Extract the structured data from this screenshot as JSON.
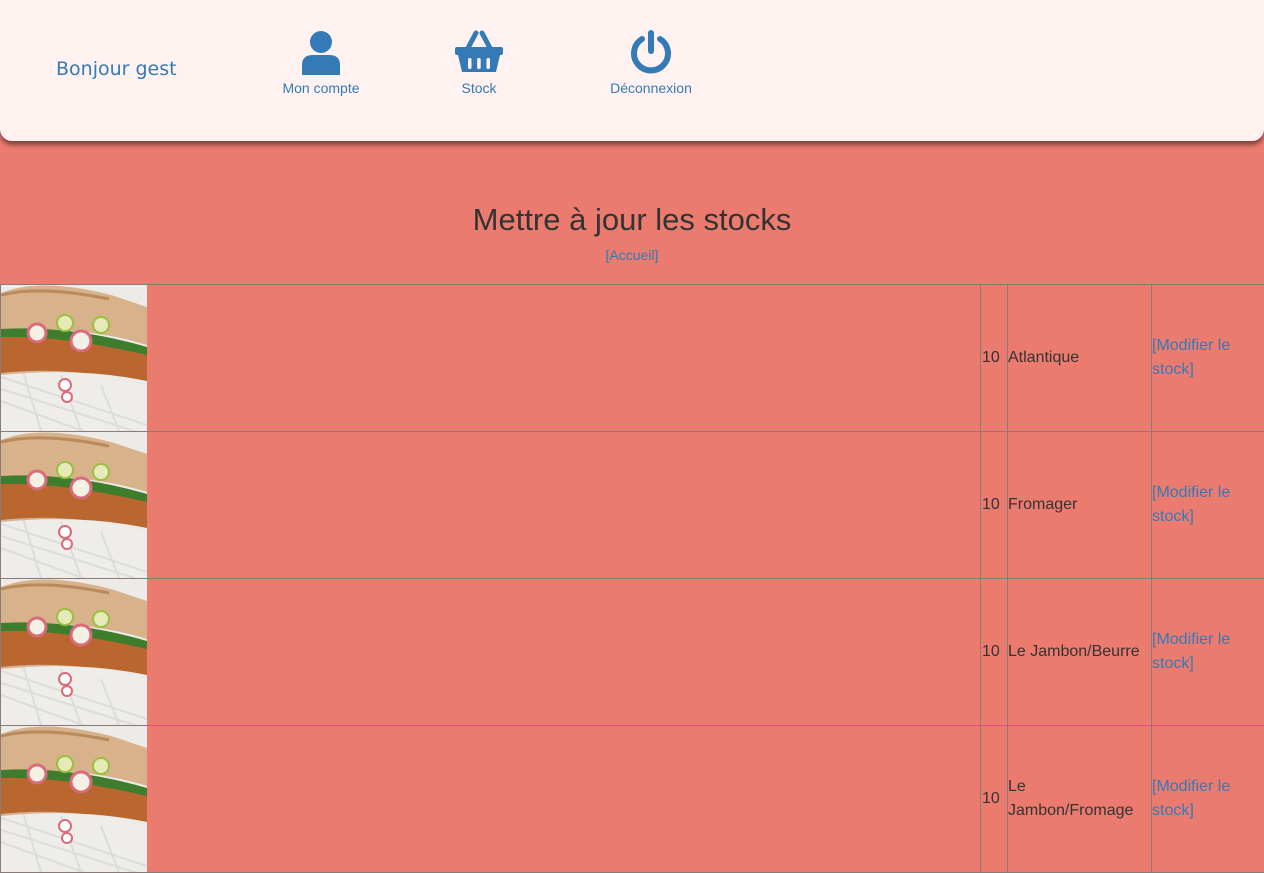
{
  "header": {
    "greeting": "Bonjour gest",
    "nav": {
      "account": {
        "label": "Mon compte",
        "icon": "user-icon"
      },
      "stock": {
        "label": "Stock",
        "icon": "basket-icon"
      },
      "logout": {
        "label": "Déconnexion",
        "icon": "power-icon"
      }
    }
  },
  "main": {
    "title": "Mettre à jour les stocks",
    "home_link": "[Accueil]"
  },
  "products": [
    {
      "quantity": "10",
      "name": "Atlantique",
      "action": "[Modifier le stock]"
    },
    {
      "quantity": "10",
      "name": "Fromager",
      "action": "[Modifier le stock]"
    },
    {
      "quantity": "10",
      "name": "Le Jambon/Beurre",
      "action": "[Modifier le stock]"
    },
    {
      "quantity": "10",
      "name": "Le Jambon/Fromage",
      "action": "[Modifier le stock]"
    }
  ],
  "colors": {
    "background": "#ec7b6f",
    "topbar": "#fff2f1",
    "link": "#337ab7",
    "text": "#333333"
  }
}
